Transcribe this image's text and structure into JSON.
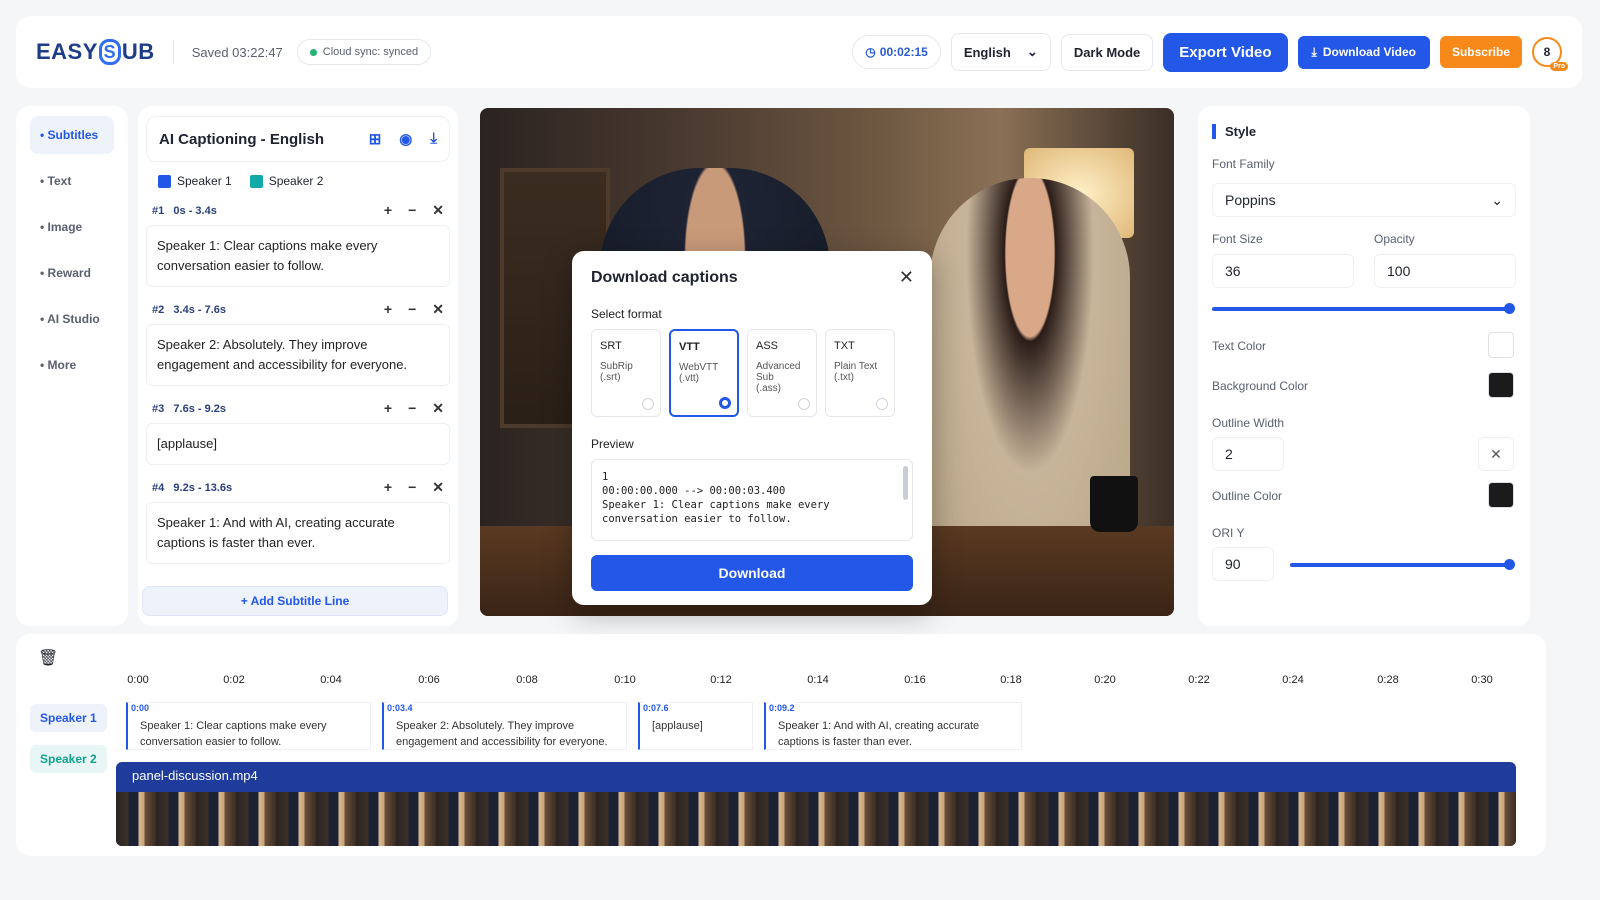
{
  "header": {
    "logo": "EASY SUB",
    "logo_a": "EASY",
    "logo_s": "S",
    "logo_b": "UB",
    "saved": "Saved 03:22:47",
    "sync": "Cloud sync: synced",
    "timer": "00:02:15",
    "language": "English",
    "dark_mode": "Dark Mode",
    "export": "Export Video",
    "download_video": "Download Video",
    "subscribe": "Subscribe",
    "avatar": "8",
    "pro": "Pro"
  },
  "nav": {
    "items": [
      "Subtitles",
      "Text",
      "Image",
      "Reward",
      "AI Studio",
      "More"
    ]
  },
  "captions": {
    "title": "AI Captioning - English",
    "speakers": [
      {
        "name": "Speaker 1",
        "color": "#2257e8"
      },
      {
        "name": "Speaker 2",
        "color": "#12a9a9"
      }
    ],
    "lines": [
      {
        "id": "#1",
        "time": "0s - 3.4s",
        "text": "Speaker 1: Clear captions make every conversation easier to follow."
      },
      {
        "id": "#2",
        "time": "3.4s - 7.6s",
        "text": "Speaker 2: Absolutely. They improve engagement and accessibility for everyone."
      },
      {
        "id": "#3",
        "time": "7.6s - 9.2s",
        "text": "[applause]"
      },
      {
        "id": "#4",
        "time": "9.2s - 13.6s",
        "text": "Speaker 1: And with AI, creating accurate captions is faster than ever."
      }
    ],
    "add_line": "+ Add Subtitle Line"
  },
  "modal": {
    "title": "Download captions",
    "select_format": "Select format",
    "formats": [
      {
        "code": "SRT",
        "name": "SubRip",
        "ext": "(.srt)",
        "selected": false
      },
      {
        "code": "VTT",
        "name": "WebVTT",
        "ext": "(.vtt)",
        "selected": true
      },
      {
        "code": "ASS",
        "name": "Advanced Sub",
        "ext": "(.ass)",
        "selected": false
      },
      {
        "code": "TXT",
        "name": "Plain Text",
        "ext": "(.txt)",
        "selected": false
      }
    ],
    "preview_label": "Preview",
    "preview_lines": [
      "1",
      "00:00:00.000 --> 00:00:03.400",
      "Speaker 1: Clear captions make every",
      "conversation easier to follow."
    ],
    "download": "Download"
  },
  "style": {
    "title": "Style",
    "font_family_label": "Font Family",
    "font_family": "Poppins",
    "font_size_label": "Font Size",
    "font_size": "36",
    "opacity_label": "Opacity",
    "opacity": "100",
    "text_color_label": "Text Color",
    "text_color": "#ffffff",
    "bg_color_label": "Background Color",
    "bg_color": "#1b1b1b",
    "outline_width_label": "Outline Width",
    "outline_width": "2",
    "outline_color_label": "Outline Color",
    "outline_color": "#1b1b1b",
    "ori_label": "ORI Y",
    "ori_y": "90"
  },
  "timeline": {
    "ticks": [
      "0:00",
      "0:02",
      "0:04",
      "0:06",
      "0:08",
      "0:10",
      "0:12",
      "0:14",
      "0:16",
      "0:18",
      "0:20",
      "0:22",
      "0:24",
      "0:28",
      "0:30"
    ],
    "speakers": [
      "Speaker 1",
      "Speaker 2"
    ],
    "segments": [
      {
        "time": "0:00",
        "text": "Speaker 1: Clear captions make every conversation easier to follow."
      },
      {
        "time": "0:03.4",
        "text": "Speaker 2: Absolutely. They improve engagement and accessibility for everyone."
      },
      {
        "time": "0:07.6",
        "text": "[applause]"
      },
      {
        "time": "0:09.2",
        "text": "Speaker 1: And with AI, creating accurate captions is faster than ever."
      }
    ],
    "video_file": "panel-discussion.mp4"
  }
}
